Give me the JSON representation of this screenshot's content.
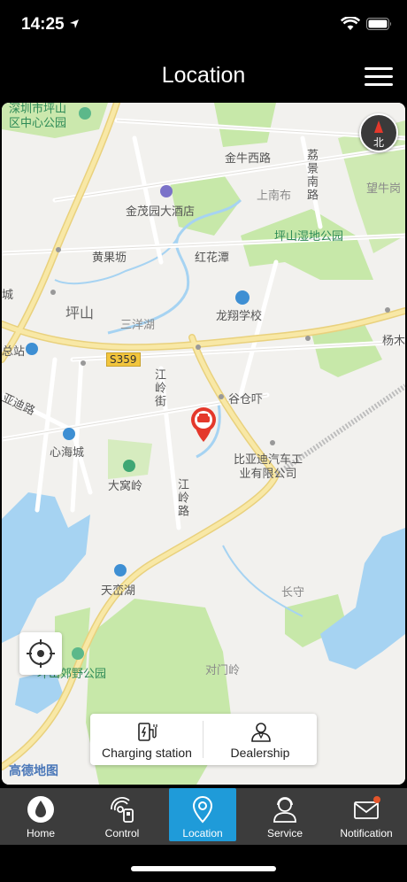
{
  "status_bar": {
    "time": "14:25"
  },
  "header": {
    "title": "Location"
  },
  "map": {
    "labels": {
      "shenzhen_park": "深圳市坪山\n区中心公园",
      "jinniu_xilu": "金牛西路",
      "lijing_nanlu": "荔景南路",
      "shangnanbu": "上南布",
      "wangniu": "望牛岗",
      "jinmaoyuan": "金茂园大酒店",
      "huangguokeng": "黄果坜",
      "honghuatan": "红花潭",
      "pingshan_wetland": "坪山湿地公园",
      "pingshan": "坪山",
      "sanyanghu": "三洋湖",
      "longxiang_school": "龙翔学校",
      "bus_station": "总站",
      "s359": "S359",
      "yangmu": "杨木",
      "jiangling_jie": "江岭街",
      "gucangxia": "谷仓吓",
      "biyadi_road": "亚迪路",
      "xinhaicheng": "心海城",
      "byd_company": "比亚迪汽车工\n业有限公司",
      "dawoling": "大窝岭",
      "jiangling_lu": "江岭路",
      "tianluanhu": "天峦湖",
      "changshou": "长守",
      "suburban_park": "坪山郊野公园",
      "duimenling": "对门岭",
      "cheng": "城"
    },
    "brand": "高德地图",
    "compass_label": "北"
  },
  "actions": {
    "charging_station": "Charging station",
    "dealership": "Dealership"
  },
  "tabs": [
    {
      "label": "Home",
      "icon": "home-drop-icon"
    },
    {
      "label": "Control",
      "icon": "control-car-icon"
    },
    {
      "label": "Location",
      "icon": "location-pin-icon",
      "active": true
    },
    {
      "label": "Service",
      "icon": "service-agent-icon"
    },
    {
      "label": "Notification",
      "icon": "mail-icon",
      "badge": true
    }
  ],
  "colors": {
    "active_tab": "#1f9bd9",
    "tab_bar": "#3c3c3c",
    "marker": "#e4382b",
    "water": "#a6d3f2",
    "park": "#c7e8a9",
    "major_road": "#f6e39b"
  }
}
